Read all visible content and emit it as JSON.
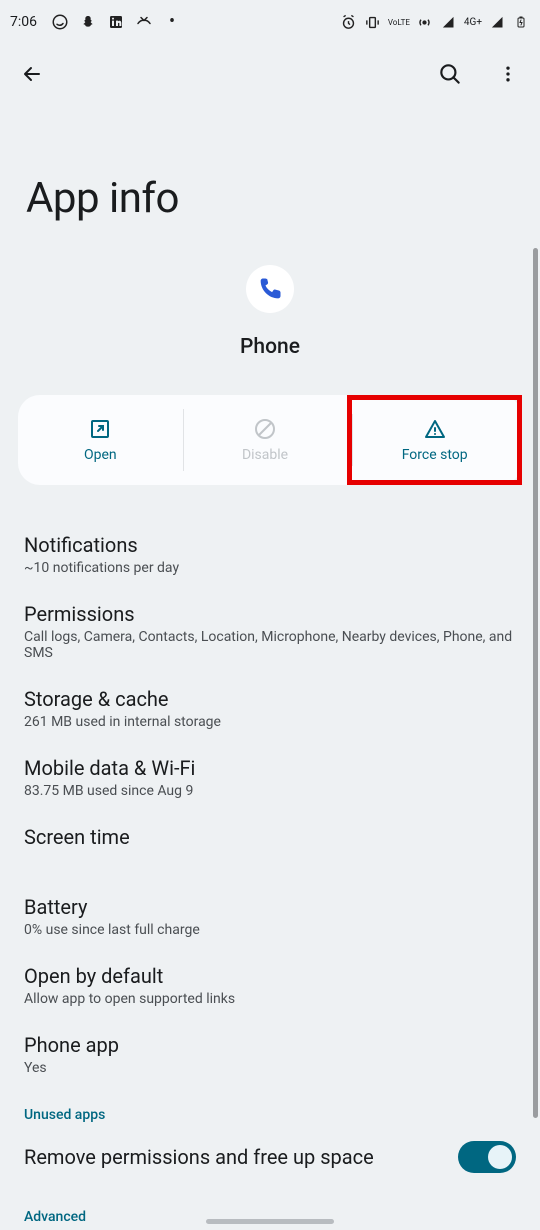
{
  "status": {
    "time": "7:06",
    "lte": "VoLTE",
    "net": "4G+"
  },
  "page": {
    "title": "App info"
  },
  "app": {
    "name": "Phone"
  },
  "actions": {
    "open": "Open",
    "disable": "Disable",
    "force_stop": "Force stop"
  },
  "items": [
    {
      "title": "Notifications",
      "sub": "~10 notifications per day"
    },
    {
      "title": "Permissions",
      "sub": "Call logs, Camera, Contacts, Location, Microphone, Nearby devices, Phone, and SMS"
    },
    {
      "title": "Storage & cache",
      "sub": "261 MB used in internal storage"
    },
    {
      "title": "Mobile data & Wi-Fi",
      "sub": "83.75 MB used since Aug 9"
    },
    {
      "title": "Screen time",
      "sub": ""
    },
    {
      "title": "Battery",
      "sub": "0% use since last full charge"
    },
    {
      "title": "Open by default",
      "sub": "Allow app to open supported links"
    },
    {
      "title": "Phone app",
      "sub": "Yes"
    }
  ],
  "section": "Unused apps",
  "toggle": {
    "title": "Remove permissions and free up space",
    "on": true
  },
  "advanced": "Advanced"
}
